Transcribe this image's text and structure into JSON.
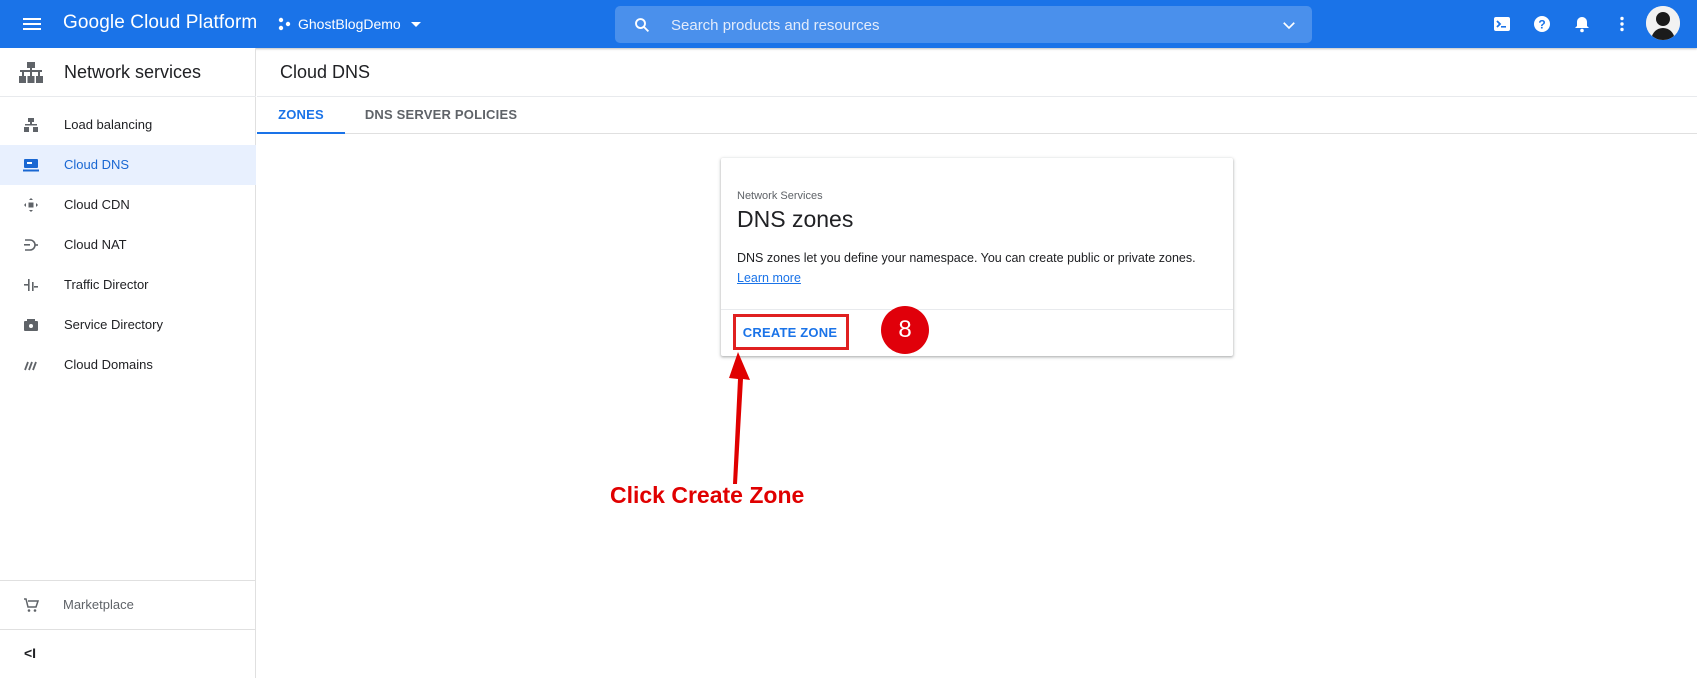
{
  "topbar": {
    "brand": "Google Cloud Platform",
    "project": "GhostBlogDemo",
    "search_placeholder": "Search products and resources",
    "icons": [
      "menu-icon",
      "terminal-icon",
      "help-icon",
      "notifications-icon",
      "more-vert-icon",
      "avatar"
    ]
  },
  "sidebar": {
    "title": "Network services",
    "items": [
      {
        "label": "Load balancing",
        "icon": "load-balancing-icon",
        "active": false
      },
      {
        "label": "Cloud DNS",
        "icon": "dns-icon",
        "active": true
      },
      {
        "label": "Cloud CDN",
        "icon": "cdn-icon",
        "active": false
      },
      {
        "label": "Cloud NAT",
        "icon": "nat-icon",
        "active": false
      },
      {
        "label": "Traffic Director",
        "icon": "traffic-director-icon",
        "active": false
      },
      {
        "label": "Service Directory",
        "icon": "service-directory-icon",
        "active": false
      },
      {
        "label": "Cloud Domains",
        "icon": "domains-icon",
        "active": false
      }
    ],
    "marketplace": "Marketplace",
    "collapse": "<I"
  },
  "main": {
    "title": "Cloud DNS",
    "tabs": [
      {
        "label": "ZONES",
        "active": true
      },
      {
        "label": "DNS SERVER POLICIES",
        "active": false
      }
    ]
  },
  "card": {
    "eyebrow": "Network Services",
    "title": "DNS zones",
    "description": "DNS zones let you define your namespace. You can create public or private zones.",
    "learn_more": "Learn more",
    "action": "CREATE ZONE"
  },
  "annotation": {
    "step": "8",
    "text": "Click Create Zone",
    "color": "#e00000"
  },
  "colors": {
    "primary": "#1a73e8",
    "active_bg": "#e8f0fe"
  }
}
